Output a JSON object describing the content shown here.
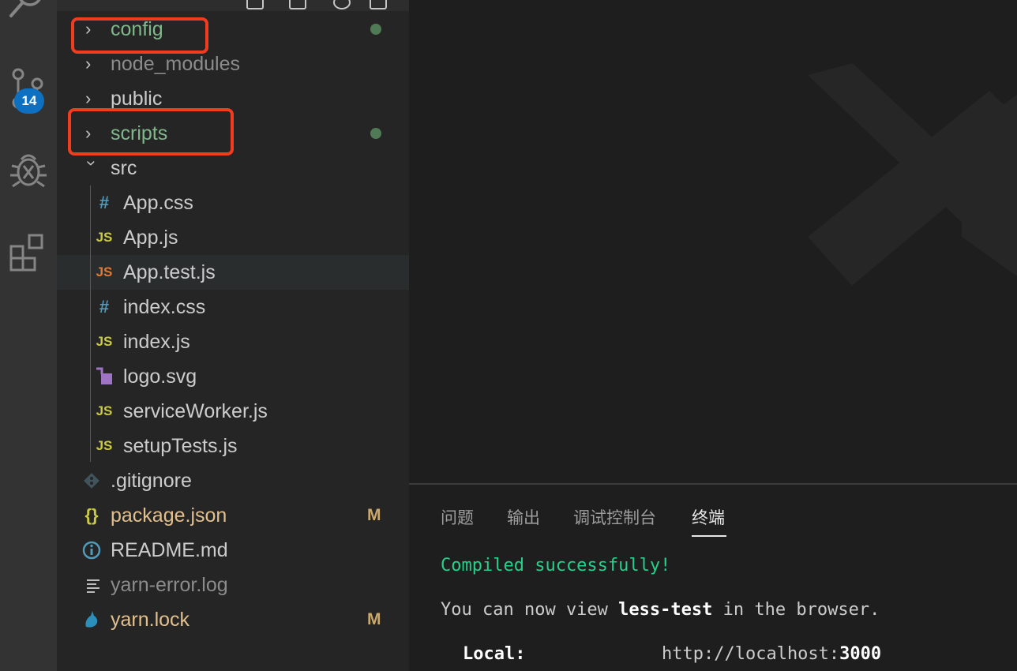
{
  "activity_bar": {
    "icons": [
      "search-icon",
      "source-control-icon",
      "debug-icon",
      "extensions-icon"
    ],
    "scm_badge": "14"
  },
  "explorer": {
    "rows": [
      {
        "label": "config",
        "type": "folder",
        "state": "collapsed",
        "status": "dot"
      },
      {
        "label": "node_modules",
        "type": "folder",
        "state": "collapsed"
      },
      {
        "label": "public",
        "type": "folder",
        "state": "collapsed"
      },
      {
        "label": "scripts",
        "type": "folder",
        "state": "collapsed",
        "status": "dot"
      },
      {
        "label": "src",
        "type": "folder",
        "state": "expanded"
      },
      {
        "label": "App.css",
        "icon": "#"
      },
      {
        "label": "App.js",
        "icon": "JS"
      },
      {
        "label": "App.test.js",
        "icon": "JS"
      },
      {
        "label": "index.css",
        "icon": "#"
      },
      {
        "label": "index.js",
        "icon": "JS"
      },
      {
        "label": "logo.svg",
        "icon": "svg-icon"
      },
      {
        "label": "serviceWorker.js",
        "icon": "JS"
      },
      {
        "label": "setupTests.js",
        "icon": "JS"
      },
      {
        "label": ".gitignore",
        "icon": "git-icon"
      },
      {
        "label": "package.json",
        "icon": "{}",
        "status": "M"
      },
      {
        "label": "README.md",
        "icon": "info-icon"
      },
      {
        "label": "yarn-error.log",
        "icon": "lines-icon"
      },
      {
        "label": "yarn.lock",
        "icon": "yarn-icon",
        "status": "M"
      }
    ]
  },
  "panel": {
    "tabs": [
      "问题",
      "输出",
      "调试控制台",
      "终端"
    ],
    "active_tab": "终端"
  },
  "terminal": {
    "compiled": "Compiled successfully!",
    "view_prefix": "You can now view ",
    "app_name": "less-test",
    "view_suffix": " in the browser.",
    "local_label": "Local:",
    "local_url_prefix": "http://localhost:",
    "local_port": "3000"
  },
  "colors": {
    "highlight_box": "#f03c1f",
    "git_added": "#81b88b",
    "git_modified": "#e2c08d",
    "terminal_success": "#23d18b"
  }
}
